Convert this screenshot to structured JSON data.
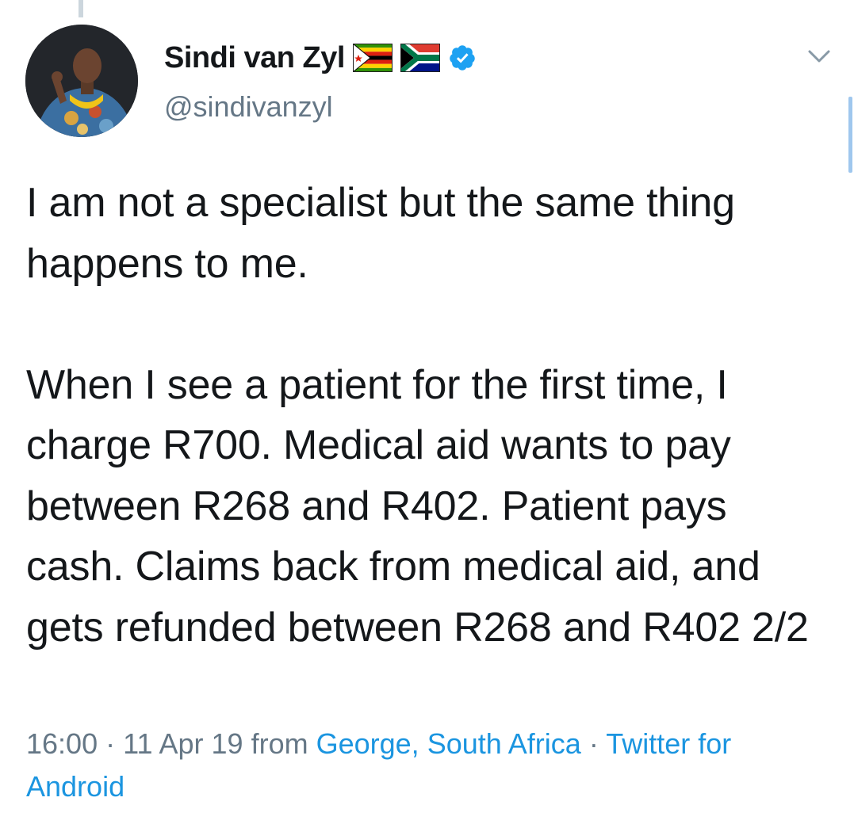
{
  "author": {
    "display_name": "Sindi van Zyl",
    "handle": "@sindivanzyl",
    "flags": [
      "zimbabwe-flag",
      "south-africa-flag"
    ],
    "verified": true
  },
  "tweet": {
    "text": "I am not a specialist but the same thing happens to me.\n\nWhen I see a patient for the first time, I charge R700. Medical aid wants to pay between R268 and R402. Patient pays cash. Claims back from medical aid, and gets refunded between R268 and R402 2/2"
  },
  "meta": {
    "time": "16:00",
    "separator": "·",
    "date": "11 Apr 19",
    "from_label": "from",
    "location": "George, South Africa",
    "source": "Twitter for Android"
  },
  "colors": {
    "text": "#14171a",
    "secondary": "#657786",
    "link": "#1b95e0",
    "verified_badge": "#1da1f2"
  },
  "icons": {
    "caret": "chevron-down-icon",
    "verified": "verified-badge-icon"
  }
}
